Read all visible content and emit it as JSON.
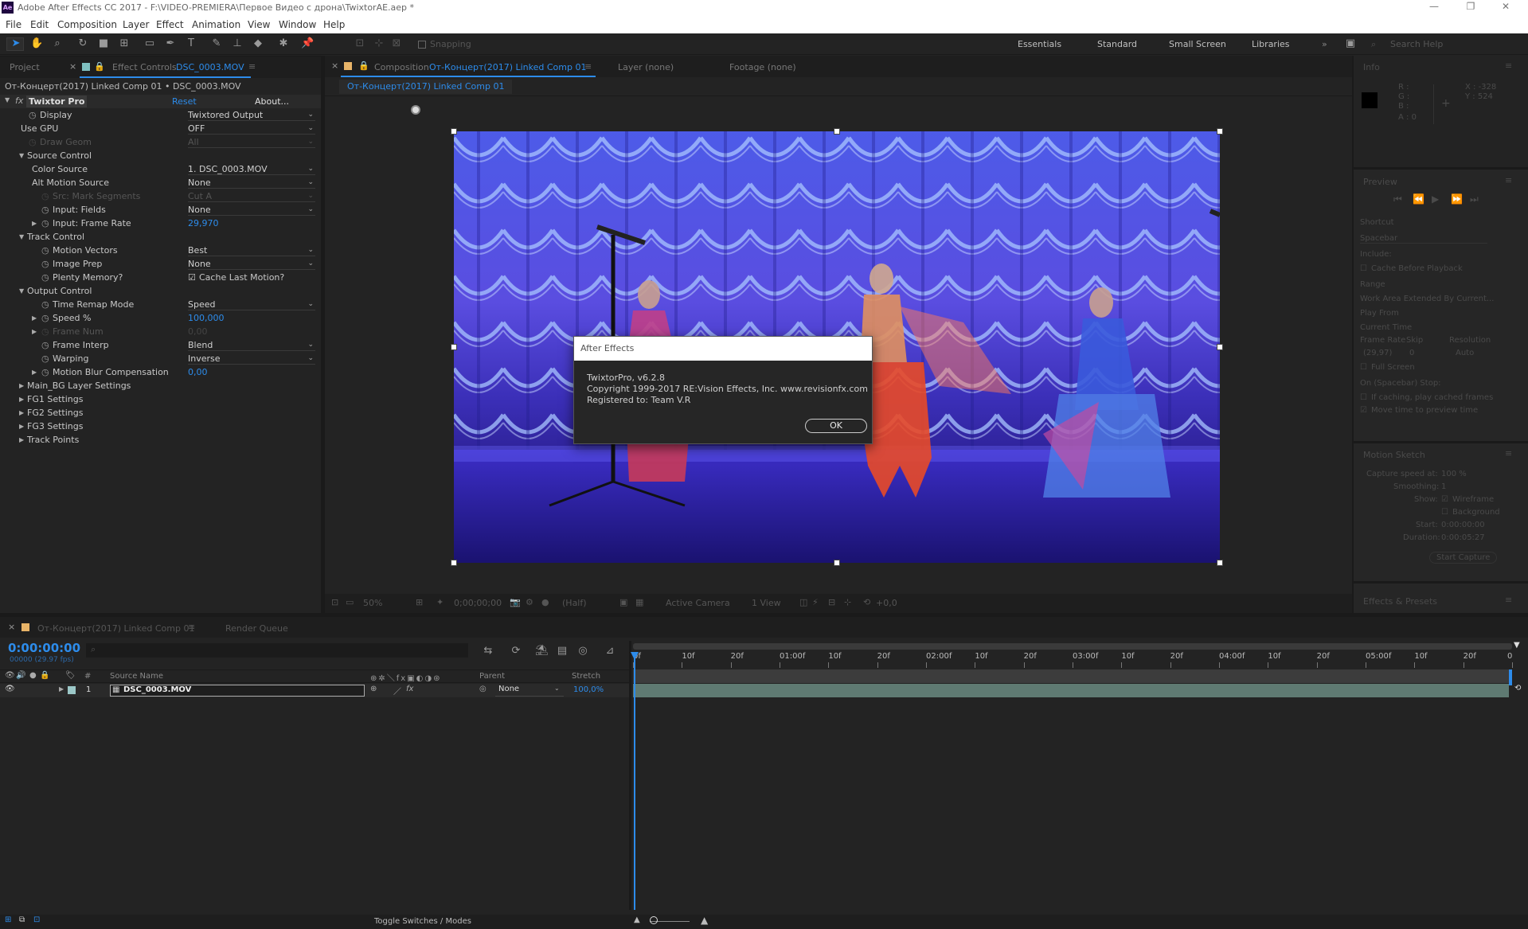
{
  "window": {
    "title": "Adobe After Effects CC 2017 - F:\\VIDEO-PREMIERA\\Первое Видео с дрона\\TwixtorAE.aep *",
    "logo": "Ae"
  },
  "menu": [
    "File",
    "Edit",
    "Composition",
    "Layer",
    "Effect",
    "Animation",
    "View",
    "Window",
    "Help"
  ],
  "toolbar": {
    "snapping": "Snapping",
    "workspaces": [
      "Essentials",
      "Standard",
      "Small Screen",
      "Libraries"
    ],
    "search_placeholder": "Search Help"
  },
  "left_panel": {
    "project_tab": "Project",
    "effect_controls_prefix": "Effect Controls",
    "effect_controls_layer": "DSC_0003.MOV",
    "breadcrumb": "От-Концерт(2017) Linked Comp 01 • DSC_0003.MOV",
    "effect_name": "Twixtor Pro",
    "reset": "Reset",
    "about": "About...",
    "rows": [
      {
        "label": "Display",
        "value": "Twixtored Output",
        "indent": 2,
        "stopwatch": true,
        "type": "dd"
      },
      {
        "label": "Use GPU",
        "value": "OFF",
        "indent": 1,
        "type": "dd"
      },
      {
        "label": "Draw Geom",
        "value": "All",
        "indent": 2,
        "stopwatch": true,
        "type": "dd",
        "dim": true
      },
      {
        "label": "Source Control",
        "indent": 1,
        "type": "group"
      },
      {
        "label": "Color Source",
        "value": "1. DSC_0003.MOV",
        "indent": 2,
        "type": "dd"
      },
      {
        "label": "Alt Motion Source",
        "value": "None",
        "indent": 2,
        "type": "dd"
      },
      {
        "label": "Src: Mark Segments",
        "value": "Cut A",
        "indent": 3,
        "stopwatch": true,
        "type": "dd",
        "dim": true
      },
      {
        "label": "Input: Fields",
        "value": "None",
        "indent": 3,
        "stopwatch": true,
        "type": "dd"
      },
      {
        "label": "Input: Frame Rate",
        "value": "29,970",
        "indent": 3,
        "stopwatch": true,
        "type": "num",
        "twirl": true
      },
      {
        "label": "Track Control",
        "indent": 1,
        "type": "group"
      },
      {
        "label": "Motion Vectors",
        "value": "Best",
        "indent": 3,
        "stopwatch": true,
        "type": "dd"
      },
      {
        "label": "Image Prep",
        "value": "None",
        "indent": 3,
        "stopwatch": true,
        "type": "dd"
      },
      {
        "label": "Plenty Memory?",
        "value": "Cache Last Motion?",
        "indent": 3,
        "stopwatch": true,
        "type": "check"
      },
      {
        "label": "Output Control",
        "indent": 1,
        "type": "group"
      },
      {
        "label": "Time Remap Mode",
        "value": "Speed",
        "indent": 3,
        "stopwatch": true,
        "type": "dd"
      },
      {
        "label": "Speed %",
        "value": "100,000",
        "indent": 3,
        "stopwatch": true,
        "type": "num",
        "twirl": true
      },
      {
        "label": "Frame Num",
        "value": "0,00",
        "indent": 3,
        "stopwatch": true,
        "type": "num",
        "twirl": true,
        "dim": true
      },
      {
        "label": "Frame Interp",
        "value": "Blend",
        "indent": 3,
        "stopwatch": true,
        "type": "dd"
      },
      {
        "label": "Warping",
        "value": "Inverse",
        "indent": 3,
        "stopwatch": true,
        "type": "dd"
      },
      {
        "label": "Motion Blur Compensation",
        "value": "0,00",
        "indent": 3,
        "stopwatch": true,
        "type": "num",
        "twirl": true
      },
      {
        "label": "Main_BG Layer Settings",
        "indent": 1,
        "type": "collapsed"
      },
      {
        "label": "FG1 Settings",
        "indent": 1,
        "type": "collapsed"
      },
      {
        "label": "FG2 Settings",
        "indent": 1,
        "type": "collapsed"
      },
      {
        "label": "FG3 Settings",
        "indent": 1,
        "type": "collapsed"
      },
      {
        "label": "Track Points",
        "indent": 1,
        "type": "collapsed"
      }
    ]
  },
  "comp_panel": {
    "tab_prefix": "Composition",
    "tab_name": "От-Концерт(2017) Linked Comp 01",
    "layer_tab": "Layer (none)",
    "footage_tab": "Footage (none)",
    "sub_tab": "От-Концерт(2017) Linked Comp 01",
    "footer": {
      "zoom": "50%",
      "time": "0;00;00;00",
      "res": "(Half)",
      "camera": "Active Camera",
      "views": "1 View",
      "exposure": "+0,0"
    }
  },
  "dialog": {
    "title": "After Effects",
    "line1": "TwixtorPro, v6.2.8",
    "line2": "Copyright 1999-2017 RE:Vision Effects, Inc. www.revisionfx.com",
    "line3": "Registered to: Team V.R",
    "ok": "OK"
  },
  "right_panel": {
    "info": {
      "title": "Info",
      "r": "R :",
      "g": "G :",
      "b": "B :",
      "a": "A : 0",
      "x": "X : -328",
      "y": "Y : 524"
    },
    "preview": {
      "title": "Preview",
      "shortcut_label": "Shortcut",
      "shortcut": "Spacebar",
      "include": "Include:",
      "cache": "Cache Before Playback",
      "range_label": "Range",
      "range": "Work Area Extended By Current...",
      "play_from_label": "Play From",
      "play_from": "Current Time",
      "fr_label": "Frame Rate",
      "skip_label": "Skip",
      "res_label": "Resolution",
      "fr": "(29,97)",
      "skip": "0",
      "res": "Auto",
      "full": "Full Screen",
      "stop": "On (Spacebar) Stop:",
      "opt1": "If caching, play cached frames",
      "opt2": "Move time to preview time"
    },
    "motion_sketch": {
      "title": "Motion Sketch",
      "speed_label": "Capture speed at:",
      "speed": "100 %",
      "smooth_label": "Smoothing:",
      "smooth": "1",
      "show_label": "Show:",
      "wire": "Wireframe",
      "bg": "Background",
      "start_label": "Start:",
      "start": "0:00:00:00",
      "dur_label": "Duration:",
      "dur": "0:00:05:27",
      "button": "Start Capture"
    },
    "effects": "Effects & Presets"
  },
  "timeline": {
    "comp_tab": "От-Концерт(2017) Linked Comp 01",
    "render_tab": "Render Queue",
    "timecode": "0:00:00:00",
    "fps": "00000 (29.97 fps)",
    "col_num": "#",
    "col_source": "Source Name",
    "col_parent": "Parent",
    "col_stretch": "Stretch",
    "layer": {
      "num": "1",
      "name": "DSC_0003.MOV",
      "parent": "None",
      "stretch": "100,0%"
    },
    "ruler": [
      "0f",
      "10f",
      "20f",
      "01:00f",
      "10f",
      "20f",
      "02:00f",
      "10f",
      "20f",
      "03:00f",
      "10f",
      "20f",
      "04:00f",
      "10f",
      "20f",
      "05:00f",
      "10f",
      "20f",
      "0"
    ],
    "toggle": "Toggle Switches / Modes"
  },
  "colors": {
    "accent": "#2d8ceb",
    "bg": "#232323",
    "panel": "#1d1d1d"
  }
}
